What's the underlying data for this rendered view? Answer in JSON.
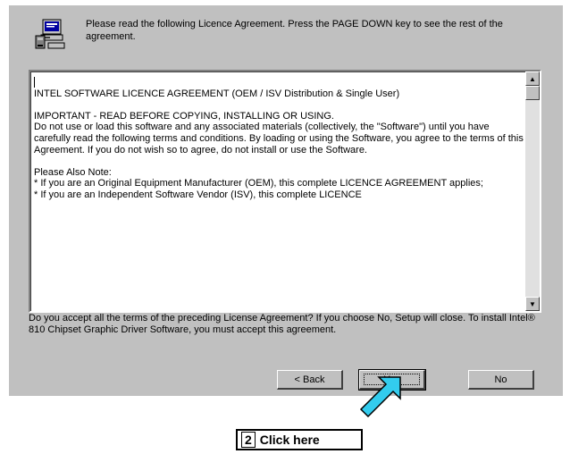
{
  "header": {
    "instruction": "Please read the following Licence Agreement.  Press the PAGE DOWN key to see the rest of the agreement."
  },
  "license": {
    "line_title": "INTEL SOFTWARE LICENCE AGREEMENT (OEM / ISV Distribution & Single User)",
    "para_important": "IMPORTANT - READ BEFORE COPYING, INSTALLING OR USING.\nDo not use or load this software and any associated materials (collectively, the \"Software\") until you have carefully read the following terms and conditions. By loading or using the Software, you agree to the terms of this Agreement. If you do not wish so to agree, do not install or use the Software.",
    "para_note": "Please Also Note:\n* If you are an Original Equipment Manufacturer (OEM), this complete LICENCE AGREEMENT applies;\n* If you are an Independent Software Vendor (ISV), this complete LICENCE"
  },
  "question": "Do you accept all the terms of the preceding License Agreement?  If you choose No,  Setup will close.  To install Intel® 810 Chipset Graphic Driver Software, you must accept this agreement.",
  "buttons": {
    "back": "< Back",
    "yes": "Yes",
    "no": "No"
  },
  "callout": {
    "number": "2",
    "text": "Click here"
  },
  "colors": {
    "dialog_bg": "#c0c0c0",
    "arrow_fill": "#33ccee"
  },
  "icons": {
    "header": "computer-install-icon",
    "scroll_up": "scroll-up-arrow-icon",
    "scroll_down": "scroll-down-arrow-icon",
    "pointer": "pointer-arrow-icon"
  }
}
